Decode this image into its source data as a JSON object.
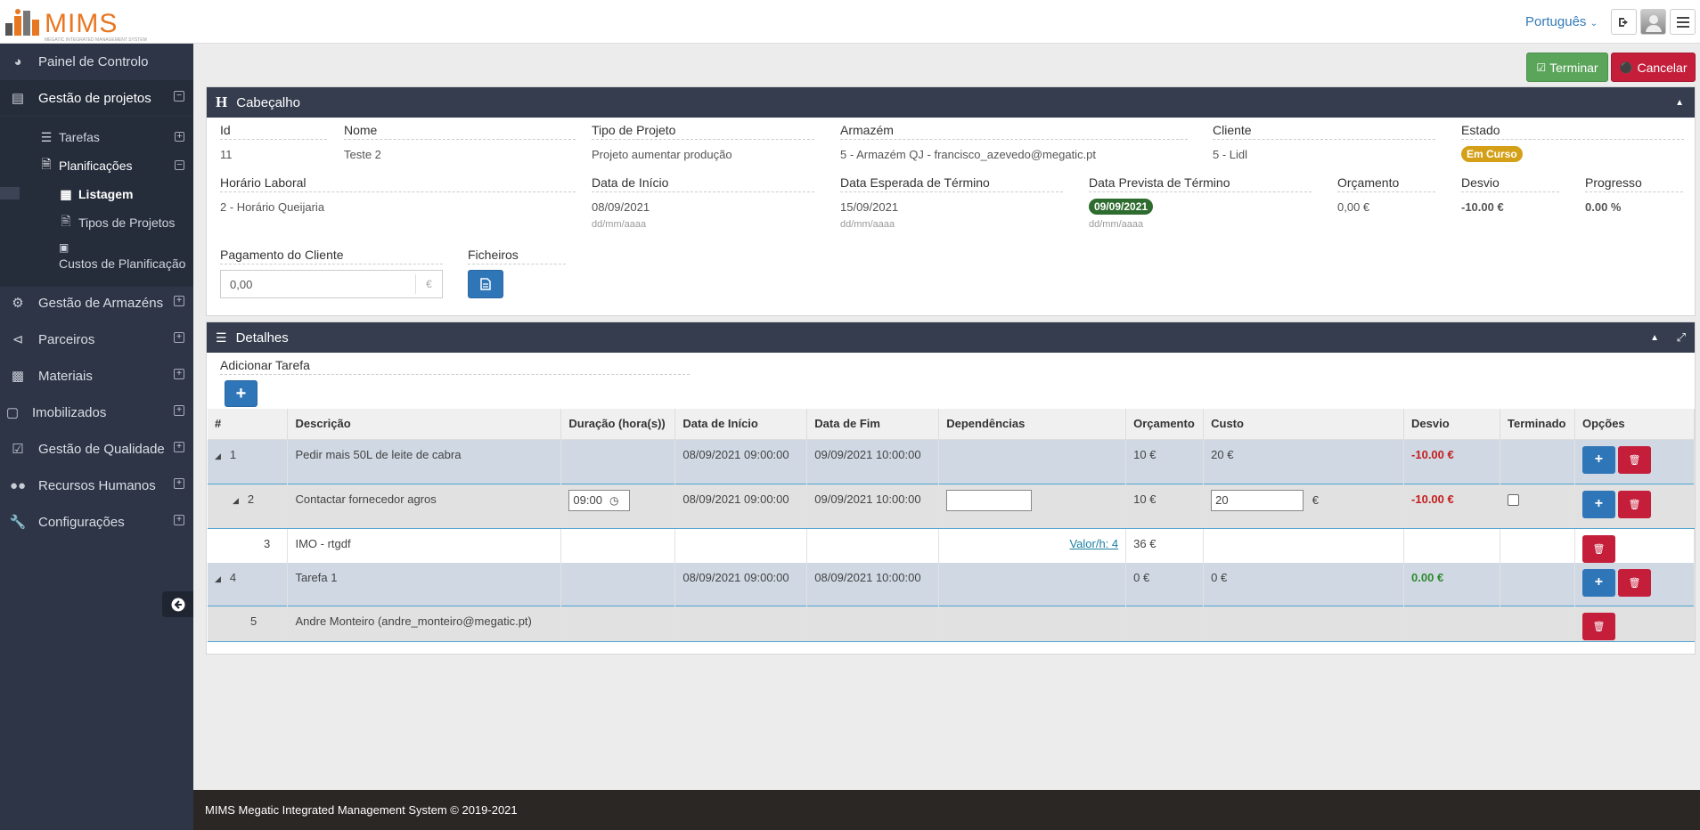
{
  "app": {
    "logo_text": "MIMS",
    "logo_tagline": "MEGATIC INTEGRATED MANAGEMENT SYSTEM"
  },
  "topbar": {
    "language": "Português"
  },
  "sidebar": {
    "items": [
      {
        "label": "Painel de Controlo",
        "icon": "dashboard-icon"
      },
      {
        "label": "Gestão de projetos",
        "icon": "projects-icon"
      },
      {
        "label": "Gestão de Armazéns",
        "icon": "warehouse-icon"
      },
      {
        "label": "Parceiros",
        "icon": "share-icon"
      },
      {
        "label": "Materiais",
        "icon": "cubes-icon"
      },
      {
        "label": "Imobilizados",
        "icon": "briefcase-icon"
      },
      {
        "label": "Gestão de Qualidade",
        "icon": "check-square-icon"
      },
      {
        "label": "Recursos Humanos",
        "icon": "users-icon"
      },
      {
        "label": "Configurações",
        "icon": "wrench-icon"
      }
    ],
    "sub": {
      "tarefas": "Tarefas",
      "planificacoes": "Planificações",
      "listagem": "Listagem",
      "tipos": "Tipos de Projetos",
      "custos": "Custos de Planificação"
    }
  },
  "actions": {
    "finish": "Terminar",
    "cancel": "Cancelar"
  },
  "header_panel": {
    "title": "Cabeçalho",
    "fields": {
      "id": {
        "label": "Id",
        "value": "11"
      },
      "nome": {
        "label": "Nome",
        "value": "Teste 2"
      },
      "tipo": {
        "label": "Tipo de Projeto",
        "value": "Projeto aumentar produção"
      },
      "armazem": {
        "label": "Armazém",
        "value": "5 - Armazém QJ - francisco_azevedo@megatic.pt"
      },
      "cliente": {
        "label": "Cliente",
        "value": "5 - Lidl"
      },
      "estado": {
        "label": "Estado",
        "value": "Em Curso"
      },
      "horario": {
        "label": "Horário Laboral",
        "value": "2 - Horário Queijaria"
      },
      "inicio": {
        "label": "Data de Início",
        "value": "08/09/2021",
        "hint": "dd/mm/aaaa"
      },
      "esperada": {
        "label": "Data Esperada de Término",
        "value": "15/09/2021",
        "hint": "dd/mm/aaaa"
      },
      "prevista": {
        "label": "Data Prevista de Término",
        "value": "09/09/2021",
        "hint": "dd/mm/aaaa"
      },
      "orcamento": {
        "label": "Orçamento",
        "value": "0,00 €"
      },
      "desvio": {
        "label": "Desvio",
        "value": "-10.00 €"
      },
      "progresso": {
        "label": "Progresso",
        "value": "0.00 %"
      },
      "pagamento": {
        "label": "Pagamento do Cliente",
        "value": "0,00",
        "currency": "€"
      },
      "ficheiros": {
        "label": "Ficheiros"
      }
    },
    "colors": {
      "estado_badge": "#d4a017",
      "prevista_badge": "#2e6b2e"
    }
  },
  "details_panel": {
    "title": "Detalhes",
    "add_task_label": "Adicionar Tarefa",
    "columns": [
      "#",
      "Descrição",
      "Duração (hora(s))",
      "Data de Início",
      "Data de Fim",
      "Dependências",
      "Orçamento",
      "Custo",
      "Desvio",
      "Terminado",
      "Opções"
    ],
    "rows": [
      {
        "num": "1",
        "desc": "Pedir mais 50L de leite de cabra",
        "dur": "",
        "start": "08/09/2021 09:00:00",
        "end": "09/09/2021 10:00:00",
        "deps": "",
        "budget": "10 €",
        "cost": "20 €",
        "dev": "-10.00 €"
      },
      {
        "num": "2",
        "desc": "Contactar fornecedor agros",
        "dur": "09:00",
        "start": "08/09/2021 09:00:00",
        "end": "09/09/2021 10:00:00",
        "deps": "",
        "budget": "10 €",
        "cost": "20",
        "cost_unit": "€",
        "dev": "-10.00 €"
      },
      {
        "num": "3",
        "desc": "IMO - rtgdf",
        "deps": "Valor/h: 4",
        "budget": "36 €"
      },
      {
        "num": "4",
        "desc": "Tarefa 1",
        "start": "08/09/2021 09:00:00",
        "end": "08/09/2021 10:00:00",
        "budget": "0 €",
        "cost": "0 €",
        "dev": "0.00 €"
      },
      {
        "num": "5",
        "desc": "Andre Monteiro (andre_monteiro@megatic.pt)"
      }
    ]
  },
  "footer": {
    "text": "MIMS Megatic Integrated Management System © 2019-2021"
  }
}
